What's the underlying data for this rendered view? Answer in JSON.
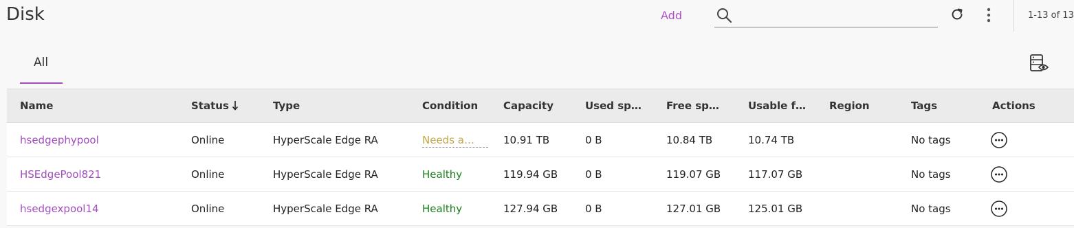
{
  "page": {
    "title": "Disk"
  },
  "toolbar": {
    "add_label": "Add",
    "search_placeholder": "",
    "pagination": "1-13 of 13"
  },
  "tabs": [
    {
      "label": "All",
      "active": true
    }
  ],
  "table": {
    "columns": [
      "Name",
      "Status",
      "Type",
      "Condition",
      "Capacity",
      "Used sp…",
      "Free sp…",
      "Usable f…",
      "Region",
      "Tags",
      "Actions"
    ],
    "sorted_column": "Status",
    "sort_direction": "descending",
    "rows": [
      {
        "name": "hsedgephypool",
        "status": "Online",
        "type": "HyperScale Edge RA",
        "condition": "Needs a…",
        "condition_state": "warning",
        "capacity": "10.91 TB",
        "used": "0 B",
        "free": "10.84 TB",
        "usable": "10.74 TB",
        "region": "",
        "tags": "No tags"
      },
      {
        "name": "HSEdgePool821",
        "status": "Online",
        "type": "HyperScale Edge RA",
        "condition": "Healthy",
        "condition_state": "healthy",
        "capacity": "119.94 GB",
        "used": "0 B",
        "free": "119.07 GB",
        "usable": "117.07 GB",
        "region": "",
        "tags": "No tags"
      },
      {
        "name": "hsedgexpool14",
        "status": "Online",
        "type": "HyperScale Edge RA",
        "condition": "Healthy",
        "condition_state": "healthy",
        "capacity": "127.94 GB",
        "used": "0 B",
        "free": "127.01 GB",
        "usable": "125.01 GB",
        "region": "",
        "tags": "No tags"
      }
    ]
  },
  "icons": {
    "search": "search-icon",
    "refresh": "refresh-icon",
    "more": "more-vertical-icon",
    "column_view": "column-view-icon",
    "row_action": "more-horizontal-circle-icon",
    "sort": "arrow-down-icon"
  },
  "colors": {
    "accent": "#a24dbf",
    "warning": "#c4a64a",
    "healthy": "#1a7f1a"
  }
}
